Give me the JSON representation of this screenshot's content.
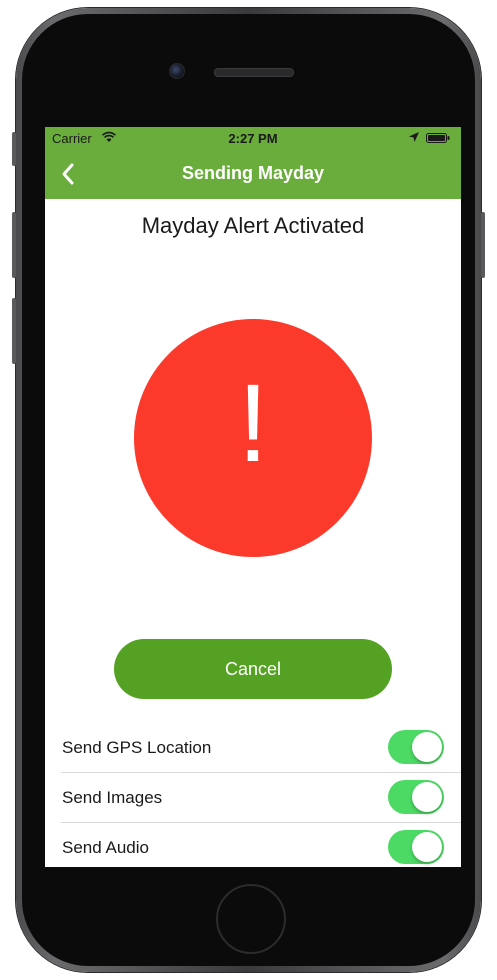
{
  "status_bar": {
    "carrier": "Carrier",
    "time": "2:27 PM",
    "wifi_icon": "wifi-icon",
    "location_icon": "location-arrow-icon",
    "battery_icon": "battery-icon"
  },
  "nav_bar": {
    "title": "Sending Mayday",
    "back_icon": "chevron-left-icon",
    "background_color": "#6aad3d"
  },
  "main": {
    "heading": "Mayday Alert Activated",
    "alert_symbol": "!",
    "alert_color": "#fb3a2c",
    "cancel_label": "Cancel",
    "cancel_color": "#55a124"
  },
  "settings": [
    {
      "label": "Send GPS Location",
      "enabled": true
    },
    {
      "label": "Send Images",
      "enabled": true
    },
    {
      "label": "Send Audio",
      "enabled": true
    }
  ],
  "toggle_on_color": "#4cd964"
}
